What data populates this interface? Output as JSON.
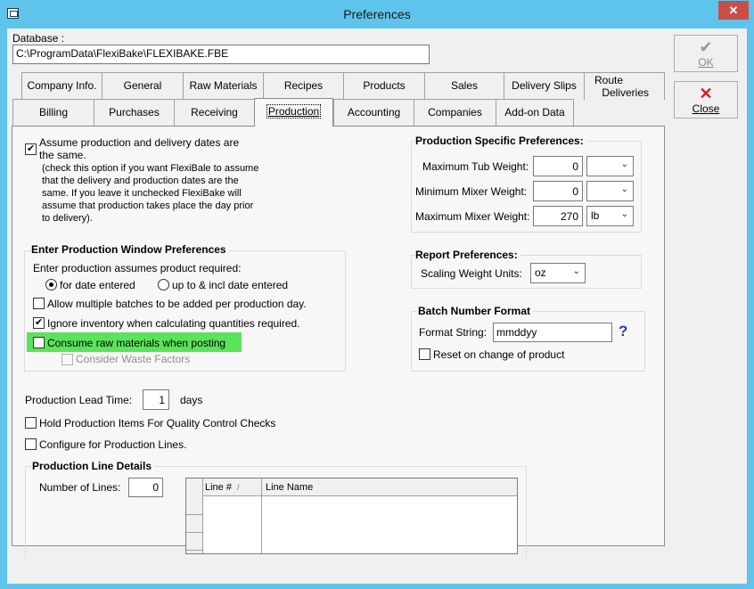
{
  "window": {
    "title": "Preferences",
    "close_glyph": "✕",
    "icon": "window-app-icon"
  },
  "database": {
    "label": "Database :",
    "path": "C:\\ProgramData\\FlexiBake\\FLEXIBAKE.FBE"
  },
  "buttons": {
    "ok": "OK",
    "ok_icon": "✔",
    "close": "Close",
    "close_icon": "✕"
  },
  "tabs_row1": [
    {
      "label": "Company Info."
    },
    {
      "label": "General"
    },
    {
      "label": "Raw Materials"
    },
    {
      "label": "Recipes"
    },
    {
      "label": "Products"
    },
    {
      "label": "Sales"
    },
    {
      "label": "Delivery Slips"
    },
    {
      "label": "Route Deliveries",
      "line1": "Route",
      "line2": "Deliveries"
    }
  ],
  "tabs_row2": [
    {
      "label": "Billing"
    },
    {
      "label": "Purchases"
    },
    {
      "label": "Receiving"
    },
    {
      "label": "Production",
      "active": true
    },
    {
      "label": "Accounting"
    },
    {
      "label": "Companies"
    },
    {
      "label": "Add-on Data"
    }
  ],
  "production": {
    "assume_dates": {
      "checked": true,
      "line1": "Assume production and delivery dates are",
      "line2": "the same.",
      "note": [
        "(check this option if you want FlexiBale to assume",
        "that the delivery and production dates are the",
        "same. If you leave it unchecked  FlexiBake will",
        "assume that production takes place the day prior",
        "to delivery)."
      ]
    },
    "window_prefs": {
      "title": "Enter Production Window Preferences",
      "assumes_label": "Enter production assumes product required:",
      "radio_date": "for date entered",
      "radio_upto": "up to & incl date entered",
      "selected": "for date entered",
      "allow_multiple": {
        "label": "Allow multiple batches to be added per production day.",
        "checked": false
      },
      "ignore_inventory": {
        "label": "Ignore inventory when calculating quantities required.",
        "checked": true
      },
      "consume_raw": {
        "label": "Consume raw materials when posting",
        "checked": false,
        "highlight_color": "#5be35b"
      },
      "waste_factors": {
        "label": "Consider Waste Factors",
        "checked": false,
        "disabled": true
      }
    },
    "lead_time": {
      "label": "Production Lead Time:",
      "value": "1",
      "unit": "days"
    },
    "hold_qc": {
      "label": "Hold Production Items For Quality Control Checks",
      "checked": false
    },
    "configure_lines": {
      "label": "Configure for Production Lines.",
      "checked": false
    },
    "line_details": {
      "title": "Production Line Details",
      "number_label": "Number of Lines:",
      "number_value": "0",
      "columns": [
        "Line #",
        "Line Name"
      ],
      "sort_glyph": "/",
      "rows": 3
    },
    "specific_prefs": {
      "title": "Production Specific Preferences:",
      "max_tub": {
        "label": "Maximum Tub Weight:",
        "value": "0",
        "unit": ""
      },
      "min_mixer": {
        "label": "Minimum Mixer Weight:",
        "value": "0",
        "unit": ""
      },
      "max_mixer": {
        "label": "Maximum Mixer Weight:",
        "value": "270",
        "unit": "lb"
      }
    },
    "report_prefs": {
      "title": "Report Preferences:",
      "scaling_label": "Scaling Weight Units:",
      "scaling_value": "oz"
    },
    "batch_format": {
      "title": "Batch Number Format",
      "format_label": "Format String:",
      "format_value": "mmddyy",
      "help_glyph": "?",
      "reset": {
        "label": "Reset on change of product",
        "checked": false
      }
    }
  },
  "colors": {
    "titlebar": "#5ec4ec",
    "close_red": "#c74f48",
    "highlight": "#5be35b",
    "help_blue": "#1f3fbf"
  }
}
